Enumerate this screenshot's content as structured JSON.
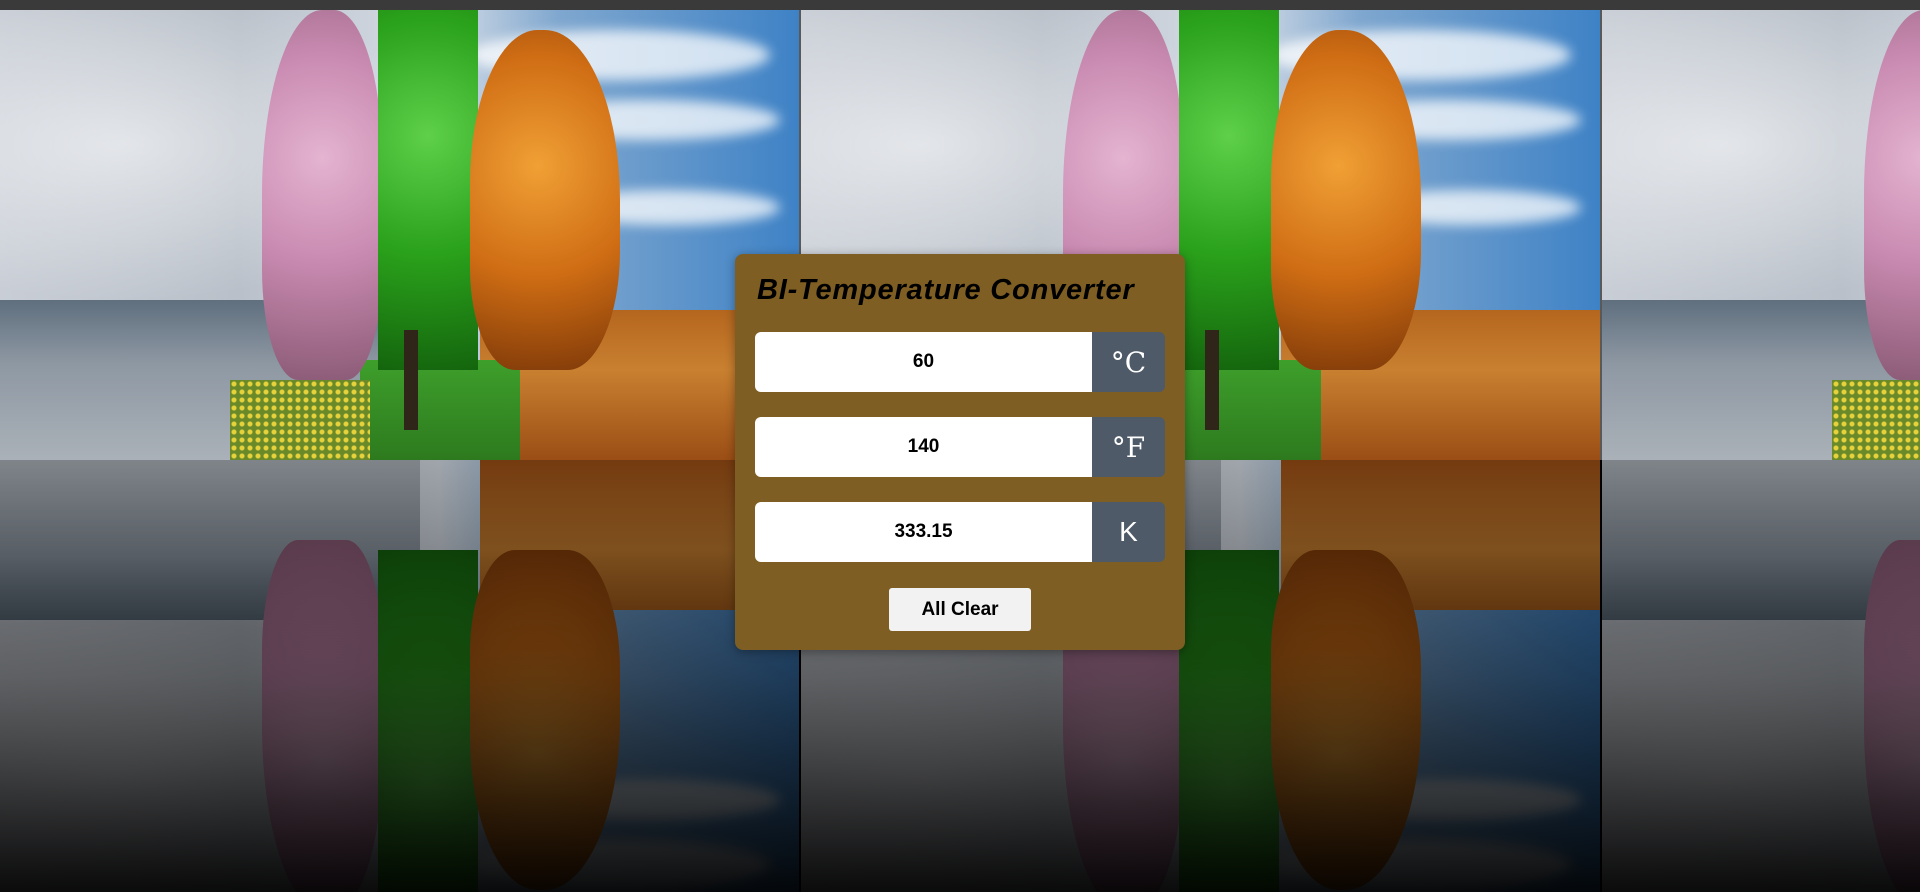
{
  "converter": {
    "title": "BI-Temperature Converter",
    "celsius": {
      "value": "60",
      "unit": "°C"
    },
    "fahrenheit": {
      "value": "140",
      "unit": "°F"
    },
    "kelvin": {
      "value": "333.15",
      "unit": "K"
    },
    "clear_label": "All Clear"
  },
  "colors": {
    "card_bg": "#7e5e23",
    "unit_bg": "#4e5a68",
    "input_bg": "#ffffff",
    "button_bg": "#f2f2f2"
  },
  "background": {
    "image": "four-seasons-trees"
  }
}
